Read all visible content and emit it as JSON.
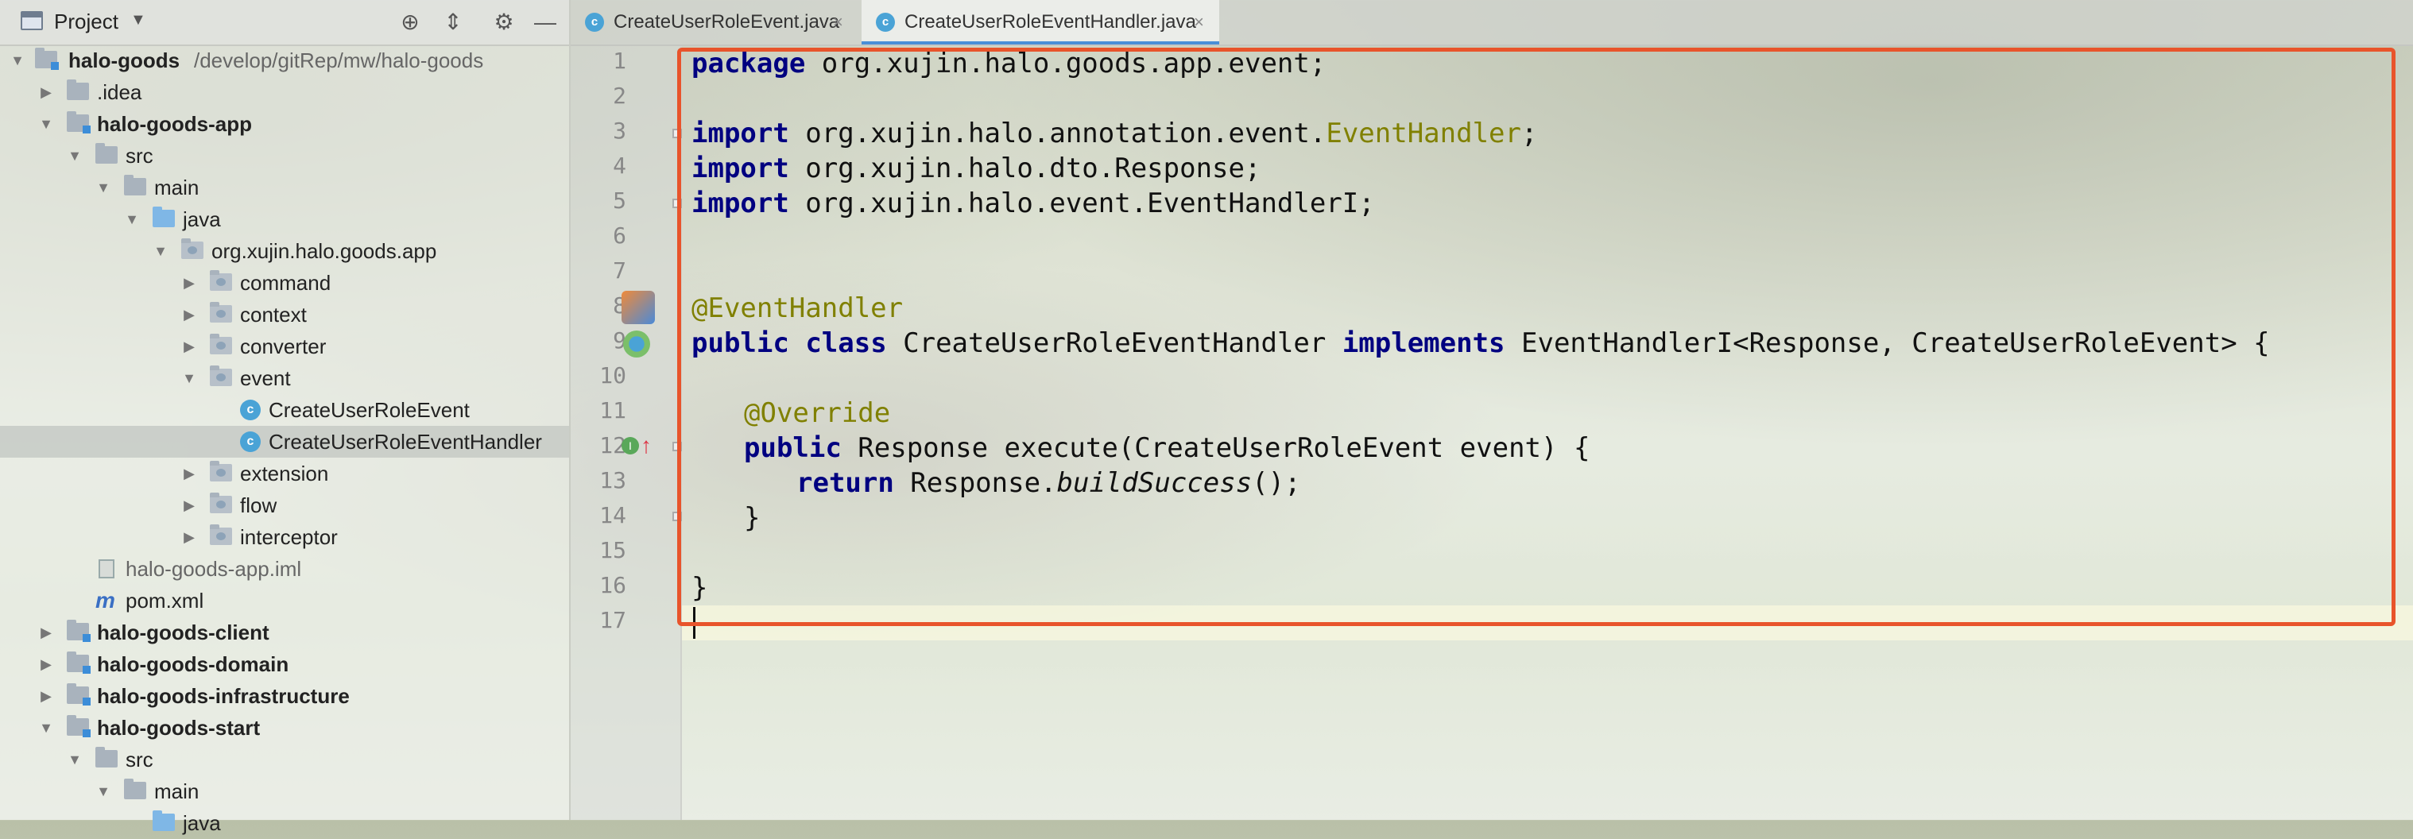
{
  "project_panel": {
    "title": "Project",
    "tree": [
      {
        "label": "halo-goods",
        "path": "/develop/gitRep/mw/halo-goods",
        "bold": true,
        "expanded": true,
        "icon": "module-folder-icon"
      },
      {
        "label": ".idea",
        "expanded": false,
        "icon": "folder-icon"
      },
      {
        "label": "halo-goods-app",
        "bold": true,
        "expanded": true,
        "icon": "module-folder-icon"
      },
      {
        "label": "src",
        "expanded": true,
        "icon": "folder-icon"
      },
      {
        "label": "main",
        "expanded": true,
        "icon": "folder-icon"
      },
      {
        "label": "java",
        "expanded": true,
        "icon": "source-folder-icon"
      },
      {
        "label": "org.xujin.halo.goods.app",
        "expanded": true,
        "icon": "package-icon"
      },
      {
        "label": "command",
        "expanded": false,
        "icon": "package-icon"
      },
      {
        "label": "context",
        "expanded": false,
        "icon": "package-icon"
      },
      {
        "label": "converter",
        "expanded": false,
        "icon": "package-icon"
      },
      {
        "label": "event",
        "expanded": true,
        "icon": "package-icon"
      },
      {
        "label": "CreateUserRoleEvent",
        "icon": "class-icon"
      },
      {
        "label": "CreateUserRoleEventHandler",
        "icon": "class-icon",
        "selected": true
      },
      {
        "label": "extension",
        "expanded": false,
        "icon": "package-icon"
      },
      {
        "label": "flow",
        "expanded": false,
        "icon": "package-icon"
      },
      {
        "label": "interceptor",
        "expanded": false,
        "icon": "package-icon"
      },
      {
        "label": "halo-goods-app.iml",
        "icon": "iml-file-icon"
      },
      {
        "label": "pom.xml",
        "icon": "maven-icon"
      },
      {
        "label": "halo-goods-client",
        "bold": true,
        "expanded": false,
        "icon": "module-folder-icon"
      },
      {
        "label": "halo-goods-domain",
        "bold": true,
        "expanded": false,
        "icon": "module-folder-icon"
      },
      {
        "label": "halo-goods-infrastructure",
        "bold": true,
        "expanded": false,
        "icon": "module-folder-icon"
      },
      {
        "label": "halo-goods-start",
        "bold": true,
        "expanded": true,
        "icon": "module-folder-icon"
      },
      {
        "label": "src",
        "expanded": true,
        "icon": "folder-icon"
      },
      {
        "label": "main",
        "expanded": true,
        "icon": "folder-icon"
      },
      {
        "label": "java",
        "expanded": false,
        "icon": "source-folder-icon"
      }
    ]
  },
  "tabs": [
    {
      "label": "CreateUserRoleEvent.java",
      "active": false
    },
    {
      "label": "CreateUserRoleEventHandler.java",
      "active": true
    }
  ],
  "tab_close_glyph": "×",
  "editor": {
    "line_numbers": [
      "1",
      "2",
      "3",
      "4",
      "5",
      "6",
      "7",
      "8",
      "9",
      "10",
      "11",
      "12",
      "13",
      "14",
      "15",
      "16",
      "17"
    ],
    "lines": {
      "l1_kw": "package",
      "l1_rest": " org.xujin.halo.goods.app.event;",
      "l3_kw": "import",
      "l3_rest": " org.xujin.halo.annotation.event.",
      "l3_ann": "EventHandler",
      "l3_end": ";",
      "l4_kw": "import",
      "l4_rest": " org.xujin.halo.dto.Response;",
      "l5_kw": "import",
      "l5_rest": " org.xujin.halo.event.EventHandlerI;",
      "l8_ann": "@EventHandler",
      "l9_kw1": "public",
      "l9_kw2": "class",
      "l9_name": " CreateUserRoleEventHandler ",
      "l9_kw3": "implements",
      "l9_rest": " EventHandlerI<Response, CreateUserRoleEvent> {",
      "l11_ann": "@Override",
      "l12_kw": "public",
      "l12_rest": " Response execute(CreateUserRoleEvent event) {",
      "l13_kw": "return",
      "l13_a": " Response.",
      "l13_it": "buildSuccess",
      "l13_b": "();",
      "l14": "}",
      "l16": "}"
    }
  },
  "colors": {
    "highlight_box": "#e8542b",
    "keyword": "#000080",
    "annotation": "#808000"
  }
}
